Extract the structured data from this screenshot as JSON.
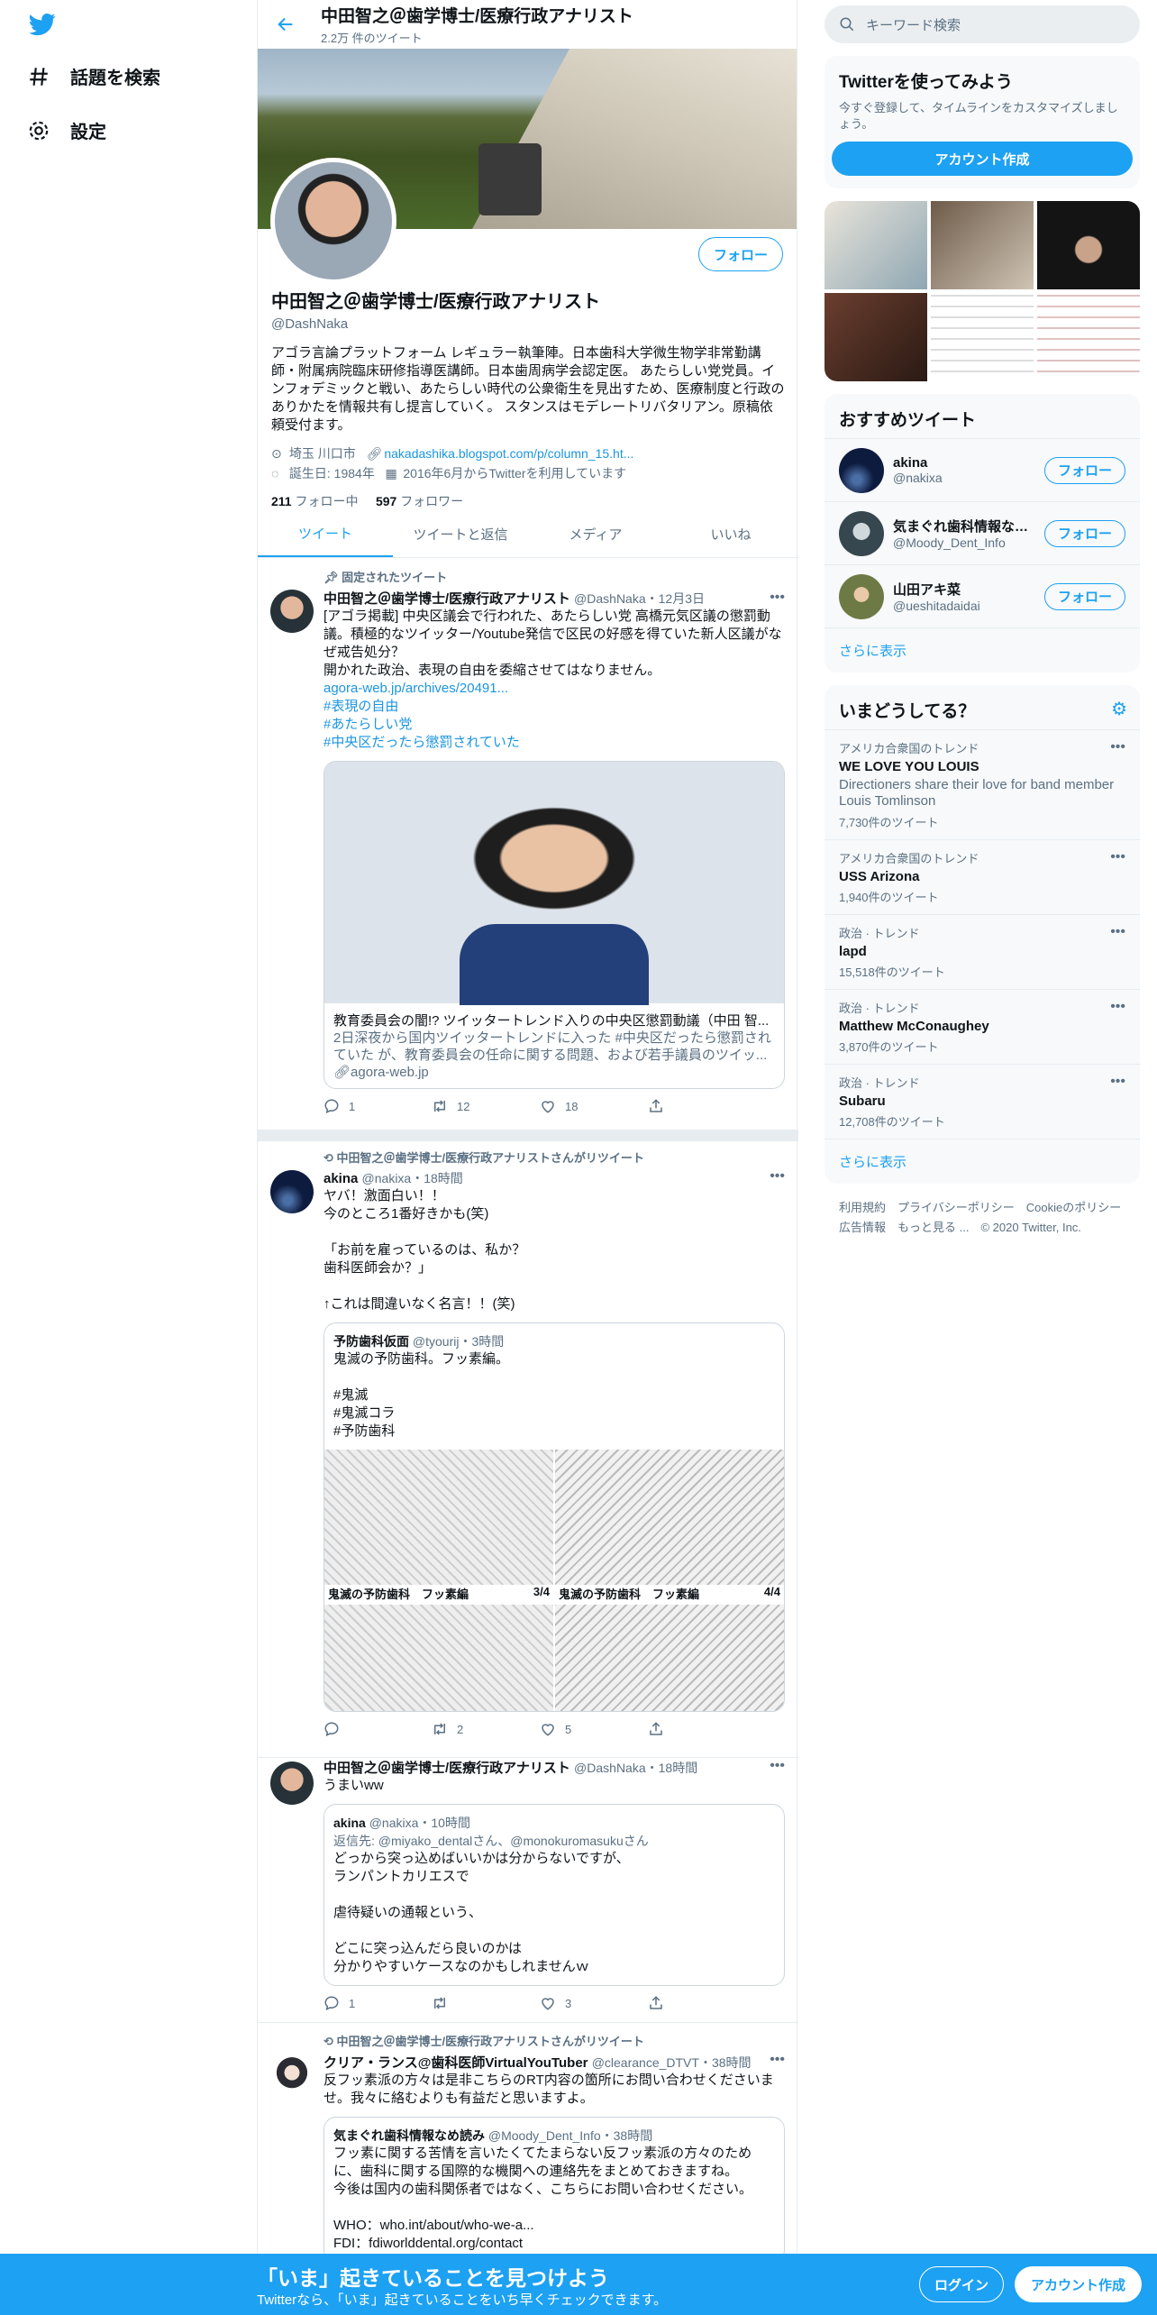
{
  "nav": {
    "explore": "話題を検索",
    "settings": "設定"
  },
  "profile_header": {
    "name": "中田智之＠歯学博士/医療行政アナリスト",
    "tweet_count": "2.2万 件のツイート"
  },
  "profile": {
    "follow": "フォロー",
    "name": "中田智之＠歯学博士/医療行政アナリスト",
    "handle": "@DashNaka",
    "bio": "アゴラ言論プラットフォーム レギュラー執筆陣。日本歯科大学微生物学非常勤講師・附属病院臨床研修指導医講師。日本歯周病学会認定医。 あたらしい党党員。インフォデミックと戦い、あたらしい時代の公衆衛生を見出すため、医療制度と行政のありかたを情報共有し提言していく。 スタンスはモデレートリバタリアン。原稿依頼受付ます。",
    "location": "埼玉 川口市",
    "url": "nakadashika.blogspot.com/p/column_15.ht...",
    "birth": "誕生日: 1984年",
    "joined": "2016年6月からTwitterを利用しています",
    "following_num": "211",
    "following_label": "フォロー中",
    "followers_num": "597",
    "followers_label": "フォロワー"
  },
  "tabs": [
    "ツイート",
    "ツイートと返信",
    "メディア",
    "いいね"
  ],
  "tweets": [
    {
      "context": "固定されたツイート",
      "name": "中田智之＠歯学博士/医療行政アナリスト",
      "handle": "@DashNaka",
      "time": "・12月3日",
      "text": "[アゴラ掲載] 中央区議会で行われた、あたらしい党 高橋元気区議の懲罰動議。積極的なツイッター/Youtube発信で区民の好感を得ていた新人区議がなぜ戒告処分？\n開かれた政治、表現の自由を委縮させてはなりません。",
      "link": "agora-web.jp/archives/20491...",
      "tags": [
        "#表現の自由",
        "#あたらしい党",
        "#中央区だったら懲罰されていた"
      ],
      "card_title": "教育委員会の闇!? ツイッタートレンド入りの中央区懲罰動議（中田 智...",
      "card_desc": "2日深夜から国内ツイッタートレンドに入った #中央区だったら懲罰されていた が、教育委員会の任命に関する問題、および若手議員のツイッ...",
      "card_domain": "agora-web.jp",
      "reply": "1",
      "rt": "12",
      "like": "18"
    },
    {
      "context": "中田智之＠歯学博士/医療行政アナリストさんがリツイート",
      "name": "akina",
      "handle": "@nakixa",
      "time": "・18時間",
      "text": "ヤバ！激面白い！！\n今のところ1番好きかも(笑)\n\n「お前を雇っているのは、私か？\n歯科医師会か？」\n\n↑これは間違いなく名言！！(笑)",
      "q_name": "予防歯科仮面",
      "q_handle": "@tyourij",
      "q_time": "・3時間",
      "q_text": "鬼滅の予防歯科。フッ素編。\n\n#鬼滅\n#鬼滅コラ\n#予防歯科",
      "manga_left": "鬼滅の予防歯科　フッ素編",
      "manga_left_page": "3/4",
      "manga_right": "鬼滅の予防歯科　フッ素編",
      "manga_right_page": "4/4",
      "rt": "2",
      "like": "5"
    },
    {
      "name": "中田智之＠歯学博士/医療行政アナリスト",
      "handle": "@DashNaka",
      "time": "・18時間",
      "text": "うまいww",
      "q_name": "akina",
      "q_handle": "@nakixa",
      "q_time": "・10時間",
      "q_reply_to": "返信先: @miyako_dentalさん、@monokuromasukuさん",
      "q_text": "どっから突っ込めばいいかは分からないですが、\nランパントカリエスで\n\n虐待疑いの通報という、\n\nどこに突っ込んだら良いのかは\n分かりやすいケースなのかもしれませんｗ",
      "reply": "1",
      "like": "3"
    },
    {
      "context": "中田智之＠歯学博士/医療行政アナリストさんがリツイート",
      "name": "クリア・ランス@歯科医師VirtualYouTuber",
      "handle": "@clearance_DTVT",
      "time": "・38時間",
      "text": "反フッ素派の方々は是非こちらのRT内容の箇所にお問い合わせくださいませ。我々に絡むよりも有益だと思いますよ。",
      "q_name": "気まぐれ歯科情報なめ読み",
      "q_handle": "@Moody_Dent_Info",
      "q_time": "・38時間",
      "q_text": "フッ素に関する苦情を言いたくてたまらない反フッ素派の方々のために、歯科に関する国際的な機関への連絡先をまとめておきますね。\n今後は国内の歯科関係者ではなく、こちらにお問い合わせください。\n\nWHO：who.int/about/who-we-a...\nFDI：fdiworlddental.org/contact"
    }
  ],
  "right": {
    "search_placeholder": "キーワード検索",
    "signup_title": "Twitterを使ってみよう",
    "signup_text": "今すぐ登録して、タイムラインをカスタマイズしましょう。",
    "signup_btn": "アカウント作成",
    "who_title": "おすすめツイート",
    "who": [
      {
        "name": "akina",
        "handle": "@nakixa"
      },
      {
        "name": "気まぐれ歯科情報なめ読み",
        "handle": "@Moody_Dent_Info"
      },
      {
        "name": "山田アキ菜",
        "handle": "@ueshitadaidai"
      }
    ],
    "follow": "フォロー",
    "show_more": "さらに表示",
    "trends_title": "いまどうしてる？",
    "trends": [
      {
        "cat": "アメリカ合衆国のトレンド",
        "name": "WE LOVE YOU LOUIS",
        "desc": "Directioners share their love for band member Louis Tomlinson",
        "count": "7,730件のツイート"
      },
      {
        "cat": "アメリカ合衆国のトレンド",
        "name": "USS Arizona",
        "desc": "",
        "count": "1,940件のツイート"
      },
      {
        "cat": "政治 · トレンド",
        "name": "lapd",
        "desc": "",
        "count": "15,518件のツイート"
      },
      {
        "cat": "政治 · トレンド",
        "name": "Matthew McConaughey",
        "desc": "",
        "count": "3,870件のツイート"
      },
      {
        "cat": "政治 · トレンド",
        "name": "Subaru",
        "desc": "",
        "count": "12,708件のツイート"
      }
    ],
    "footer1": "利用規約　プライバシーポリシー　Cookieのポリシー",
    "footer2": "広告情報　もっと見る ...　© 2020 Twitter, Inc."
  },
  "bottom": {
    "title": "「いま」起きていることを見つけよう",
    "sub": "Twitterなら、「いま」起きていることをいち早くチェックできます。",
    "login": "ログイン",
    "signup": "アカウント作成"
  }
}
